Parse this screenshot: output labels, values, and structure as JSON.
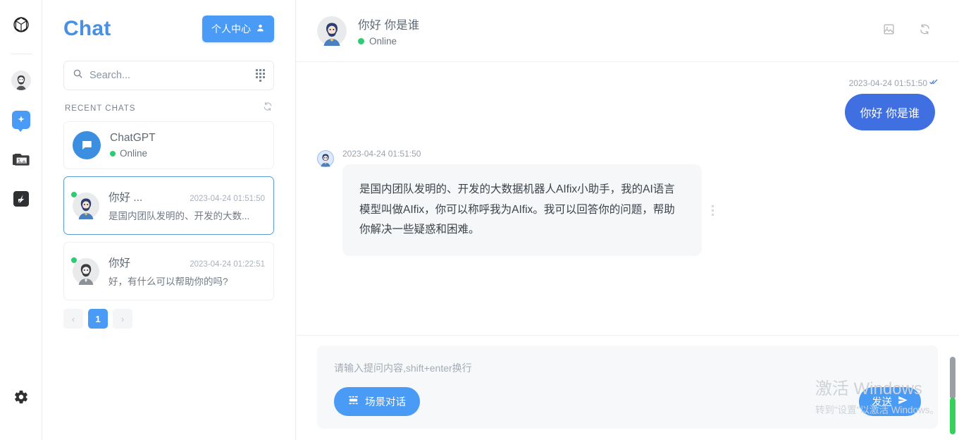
{
  "rail": {
    "items": [
      {
        "name": "openai-logo",
        "label": "OpenAI"
      },
      {
        "name": "user-avatar",
        "label": "Account"
      },
      {
        "name": "sparkle-badge",
        "label": "AI"
      },
      {
        "name": "image-folder",
        "label": "Gallery"
      },
      {
        "name": "app-logo",
        "label": "App"
      },
      {
        "name": "settings-gear",
        "label": "Settings"
      }
    ]
  },
  "panel": {
    "title": "Chat",
    "profile_button": "个人中心",
    "search": {
      "value": "",
      "placeholder": "Search..."
    },
    "recent_label": "RECENT CHATS",
    "items": [
      {
        "name": "ChatGPT",
        "status": "Online",
        "time": "",
        "preview": "",
        "type": "bot",
        "selected": false
      },
      {
        "name": "你好 ...",
        "status": "",
        "time": "2023-04-24 01:51:50",
        "preview": "是国内团队发明的、开发的大数...",
        "type": "person",
        "selected": true
      },
      {
        "name": "你好",
        "status": "",
        "time": "2023-04-24 01:22:51",
        "preview": "好，有什么可以帮助你的吗?",
        "type": "person-gray",
        "selected": false
      }
    ],
    "pagination": {
      "prev": "‹",
      "pages": [
        "1"
      ],
      "next": "›",
      "active": "1"
    }
  },
  "main": {
    "header": {
      "title": "你好 你是谁",
      "status": "Online",
      "actions": [
        {
          "name": "image-icon",
          "label": "Image"
        },
        {
          "name": "refresh-icon",
          "label": "Refresh"
        }
      ]
    },
    "messages": [
      {
        "role": "user",
        "time": "2023-04-24 01:51:50",
        "read_mark": "✓",
        "text": "你好 你是谁"
      },
      {
        "role": "assistant",
        "time": "2023-04-24 01:51:50",
        "text": "是国内团队发明的、开发的大数据机器人AIfix小助手，我的AI语言模型叫做AIfix，你可以称呼我为AIfix。我可以回答你的问题，帮助你解决一些疑惑和困难。"
      }
    ],
    "composer": {
      "placeholder": "请输入提问内容,shift+enter换行",
      "value": "",
      "scene_button": "场景对话",
      "send_button": "发送"
    }
  },
  "watermark": {
    "line1": "激活 Windows",
    "line2": "转到\"设置\"以激活 Windows。"
  },
  "colors": {
    "accent": "#4a9bf5",
    "bubble_out": "#3f6fe0",
    "bubble_in": "#f6f7f8",
    "online": "#2ecc71",
    "title": "#4a90e2"
  }
}
